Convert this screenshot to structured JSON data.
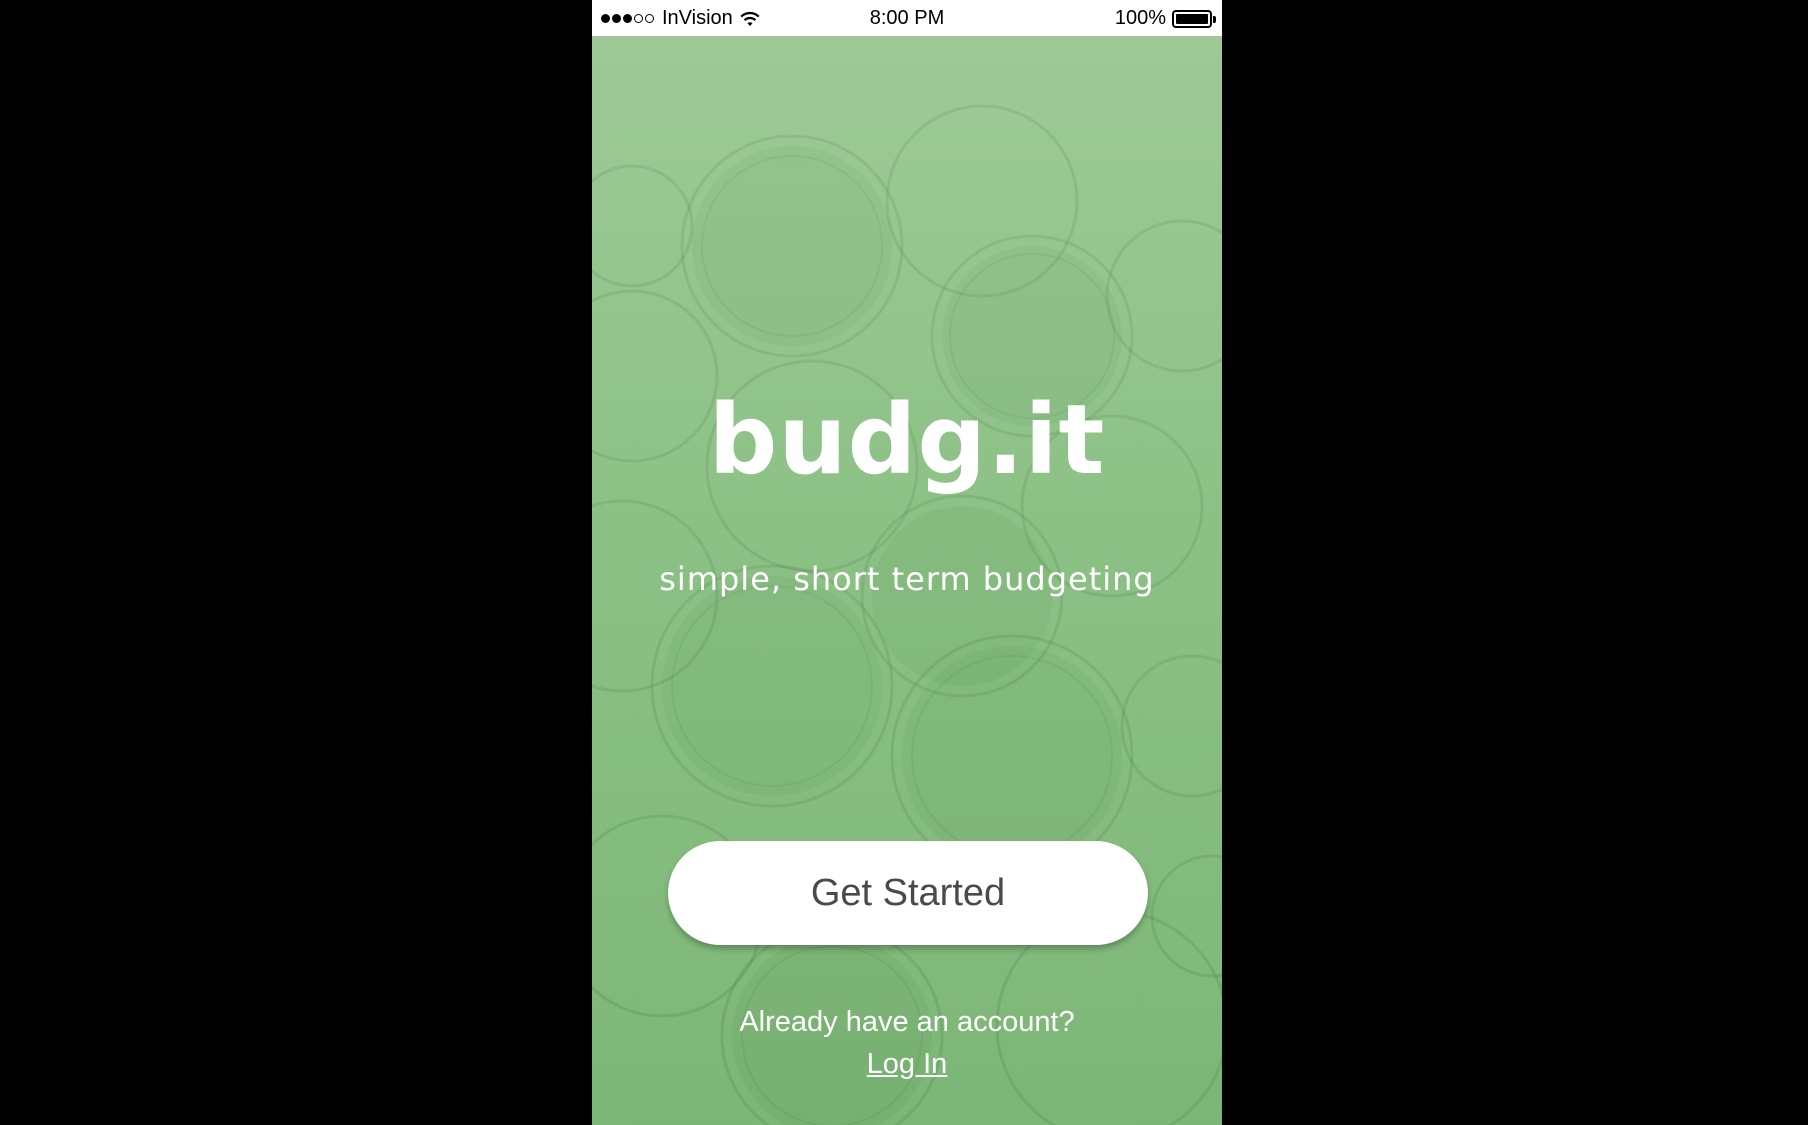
{
  "status_bar": {
    "signal_full": 3,
    "signal_empty": 2,
    "carrier": "InVision",
    "wifi_icon": "wifi-icon",
    "time": "8:00 PM",
    "battery_percent": "100%",
    "battery_level": 1.0
  },
  "welcome": {
    "app_name": "budg.it",
    "tagline": "simple, short term budgeting",
    "get_started_label": "Get Started",
    "account_prompt": "Already have an account?",
    "login_label": "Log In"
  },
  "colors": {
    "background_green": "#85bd7f",
    "button_bg": "#ffffff",
    "button_text": "#4a4a4a",
    "text_white": "#ffffff"
  }
}
